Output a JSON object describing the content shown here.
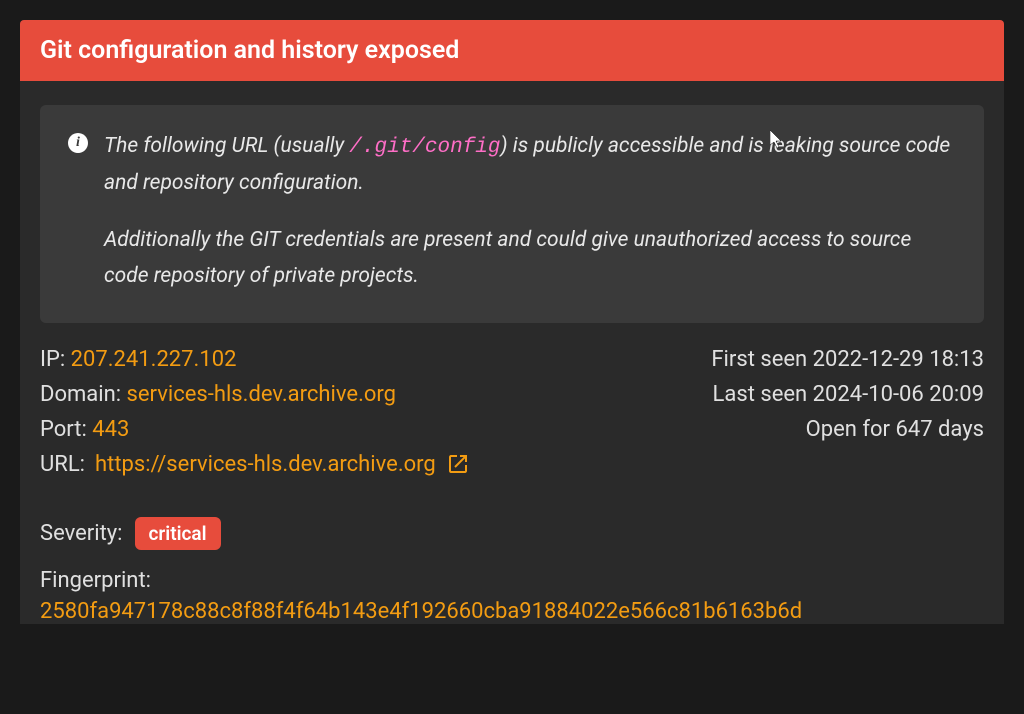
{
  "header": {
    "title": "Git configuration and history exposed"
  },
  "info": {
    "part1": "The following URL (usually ",
    "code": "/.git/config",
    "part2": ") is publicly accessible and is leaking source code and repository configuration.",
    "para2": "Additionally the GIT credentials are present and could give unauthorized access to source code repository of private projects."
  },
  "details": {
    "ip_label": "IP: ",
    "ip": "207.241.227.102",
    "domain_label": "Domain: ",
    "domain": "services-hls.dev.archive.org",
    "port_label": "Port: ",
    "port": "443",
    "url_label": "URL: ",
    "url": "https://services-hls.dev.archive.org",
    "first_seen_label": "First seen ",
    "first_seen": "2022-12-29 18:13",
    "last_seen_label": "Last seen ",
    "last_seen": "2024-10-06 20:09",
    "open_for_label": "Open for ",
    "open_for": "647 days"
  },
  "severity": {
    "label": "Severity:",
    "value": "critical"
  },
  "fingerprint": {
    "label": "Fingerprint:",
    "value": "2580fa947178c88c8f88f4f64b143e4f192660cba91884022e566c81b6163b6d"
  }
}
